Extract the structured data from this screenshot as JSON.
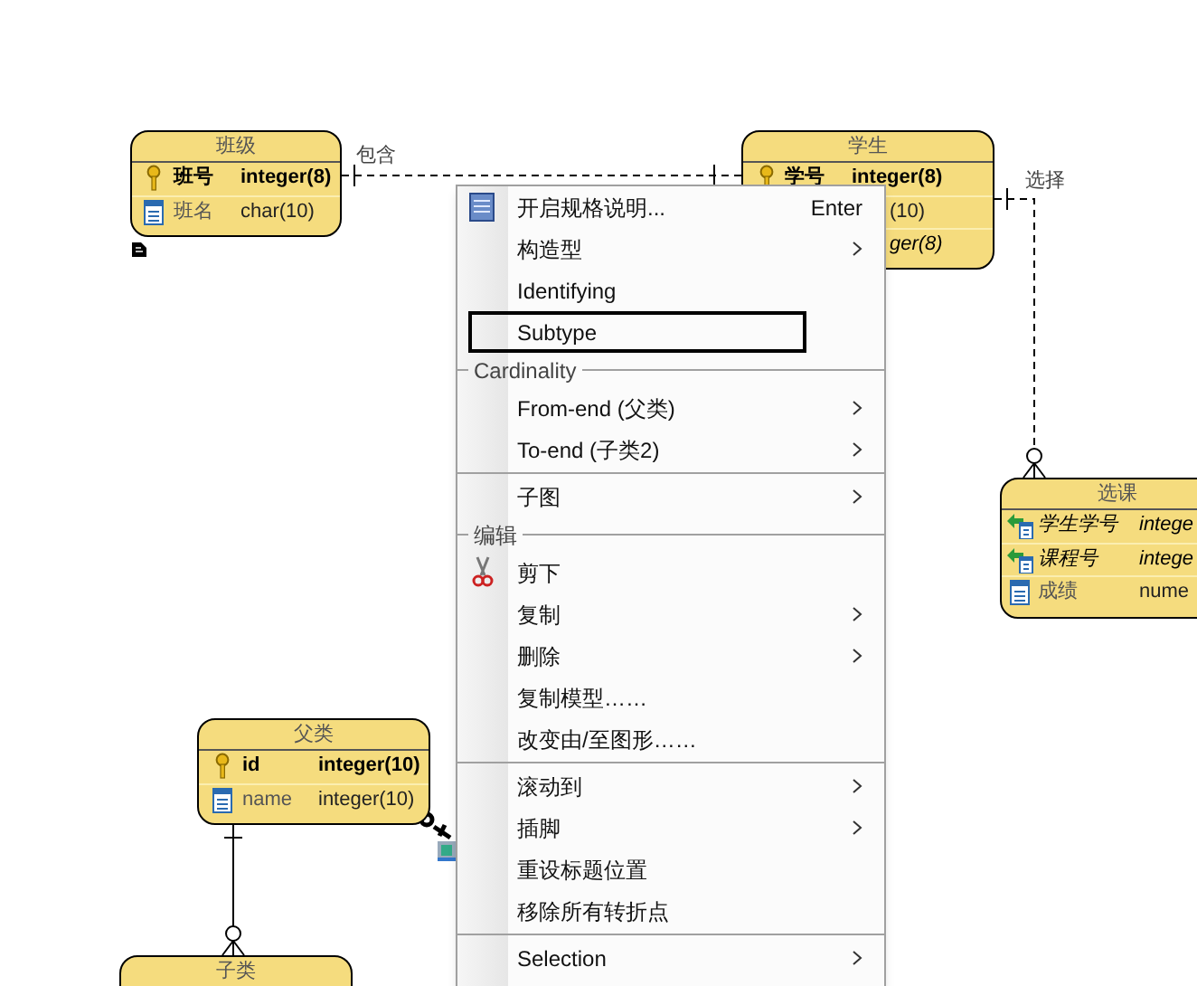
{
  "diagram": {
    "entities": [
      {
        "title": "班级",
        "rows": [
          {
            "kind": "key",
            "name": "班号",
            "type": "integer(8)"
          },
          {
            "kind": "column",
            "name": "班名",
            "type": "char(10)"
          }
        ]
      },
      {
        "title": "学生",
        "rows": [
          {
            "kind": "key",
            "name": "学号",
            "type": "integer(8)"
          },
          {
            "kind": "column",
            "type": "(10)"
          },
          {
            "kind": "foreign_key",
            "type": "ger(8)"
          }
        ]
      },
      {
        "title": "选课",
        "rows": [
          {
            "kind": "foreign_key",
            "name": "学生学号",
            "type": "intege"
          },
          {
            "kind": "foreign_key",
            "name": "课程号",
            "type": "intege"
          },
          {
            "kind": "column",
            "name": "成绩",
            "type": "nume"
          }
        ]
      },
      {
        "title": "父类",
        "rows": [
          {
            "kind": "key",
            "name": "id",
            "type": "integer(10)"
          },
          {
            "kind": "column",
            "name": "name",
            "type": "integer(10)"
          }
        ]
      },
      {
        "title": "子类"
      }
    ],
    "relationships": [
      {
        "label": "包含"
      },
      {
        "label": "选择"
      }
    ]
  },
  "context_menu": {
    "items": [
      {
        "kind": "item",
        "label": "开启规格说明...",
        "shortcut": "Enter",
        "submenu": false,
        "highlighted": false
      },
      {
        "kind": "item",
        "label": "构造型",
        "submenu": true,
        "highlighted": false
      },
      {
        "kind": "item",
        "label": "Identifying",
        "submenu": false,
        "highlighted": false
      },
      {
        "kind": "item",
        "label": "Subtype",
        "submenu": false,
        "highlighted": true
      },
      {
        "kind": "header",
        "label": "Cardinality"
      },
      {
        "kind": "item",
        "label": "From-end (父类)",
        "submenu": true,
        "highlighted": false
      },
      {
        "kind": "item",
        "label": "To-end (子类2)",
        "submenu": true,
        "highlighted": false
      },
      {
        "kind": "separator"
      },
      {
        "kind": "item",
        "label": "子图",
        "submenu": true,
        "highlighted": false
      },
      {
        "kind": "header",
        "label": "编辑"
      },
      {
        "kind": "item",
        "label": "剪下",
        "submenu": false,
        "highlighted": false
      },
      {
        "kind": "item",
        "label": "复制",
        "submenu": true,
        "highlighted": false
      },
      {
        "kind": "item",
        "label": "删除",
        "submenu": true,
        "highlighted": false
      },
      {
        "kind": "item",
        "label": "复制模型……",
        "submenu": false,
        "highlighted": false
      },
      {
        "kind": "item",
        "label": "改变由/至图形……",
        "submenu": false,
        "highlighted": false
      },
      {
        "kind": "separator"
      },
      {
        "kind": "item",
        "label": "滚动到",
        "submenu": true,
        "highlighted": false
      },
      {
        "kind": "item",
        "label": "插脚",
        "submenu": true,
        "highlighted": false
      },
      {
        "kind": "item",
        "label": "重设标题位置",
        "submenu": false,
        "highlighted": false
      },
      {
        "kind": "item",
        "label": "移除所有转折点",
        "submenu": false,
        "highlighted": false
      },
      {
        "kind": "separator"
      },
      {
        "kind": "item",
        "label": "Selection",
        "submenu": true,
        "highlighted": false
      }
    ]
  }
}
